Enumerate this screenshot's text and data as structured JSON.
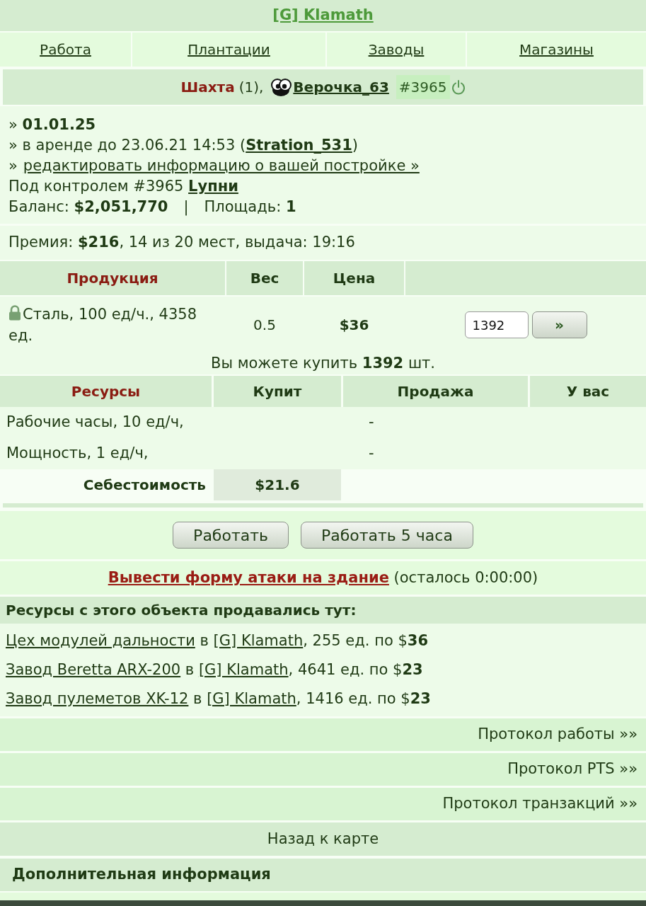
{
  "title": "[G] Klamath",
  "nav": [
    {
      "label": "Работа"
    },
    {
      "label": "Плантации"
    },
    {
      "label": "Заводы"
    },
    {
      "label": "Магазины"
    }
  ],
  "building": {
    "type": "Шахта",
    "count": "(1),",
    "owner": "Верочка_63",
    "id": "#3965"
  },
  "info": {
    "date_line": "» **01.01.25**",
    "rent": {
      "before": "» в аренде до 23.06.21 14:53 (",
      "renter": "Stration_531",
      "after": ")"
    },
    "edit": {
      "prefix": "»",
      "link": "редактировать информацию о вашей постройке »"
    },
    "control": {
      "text": "Под контролем #3965",
      "controller": "Lупни"
    },
    "balance": "Баланс: **$2,051,770**",
    "separator": "|",
    "area": "Площадь: **1**"
  },
  "bonus": "Премия: **$216**, 14 из 20 мест, выдача: 19:16",
  "production": {
    "columns": [
      "Продукция",
      "Вес",
      "Цена"
    ],
    "rows": [
      {
        "locked": true,
        "name": "Сталь, 100 ед/ч., 4358 ед.",
        "weight": "0.5",
        "price": "$36",
        "quantity": "1392",
        "buy_button": "»"
      }
    ],
    "can_buy": "Вы можете купить **1392** шт."
  },
  "resources": {
    "columns": [
      "Ресурсы",
      "Купит",
      "Продажа",
      "У вас"
    ],
    "rows": [
      {
        "name": "Рабочие часы, 10 ед/ч,",
        "sell": "-"
      },
      {
        "name": "Мощность, 1 ед/ч,",
        "sell": "-"
      }
    ],
    "cost": {
      "label": "Себестоимость",
      "value": "$21.6"
    }
  },
  "actions": [
    "Работать",
    "Работать 5 часа"
  ],
  "attack": {
    "link": "Вывести форму атаки на здание",
    "remaining": "(осталось 0:00:00)"
  },
  "sales": {
    "title": "Ресурсы с этого объекта продавались тут:",
    "items": [
      {
        "building": "Цех модулей дальности",
        "preposition": "в",
        "city": "[G] Klamath",
        "details": ", 255 ед. по $**36**"
      },
      {
        "building": "Завод Beretta ARX-200",
        "preposition": "в",
        "city": "[G] Klamath",
        "details": ", 4641 ед. по $**23**"
      },
      {
        "building": "Завод пулеметов XK-12",
        "preposition": "в",
        "city": "[G] Klamath",
        "details": ", 1416 ед. по $**23**"
      }
    ]
  },
  "protocols": [
    "Протокол работы »»",
    "Протокол PTS »»",
    "Протокол транзакций »»"
  ],
  "back_link": "Назад к карте",
  "extra_heading": "Дополнительная информация"
}
